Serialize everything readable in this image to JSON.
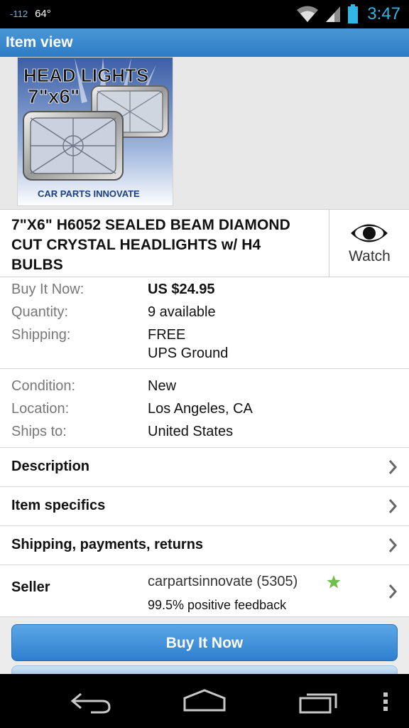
{
  "status_bar": {
    "signal_text": "-112",
    "temperature": "64°",
    "time": "3:47"
  },
  "action_bar": {
    "title": "Item view"
  },
  "listing": {
    "image_caption_top": "HEAD LIGHTS",
    "image_caption_size": "7\"x6\"",
    "image_brand": "CAR PARTS INNOVATE",
    "title": "7\"X6\" H6052 SEALED BEAM DIAMOND CUT CRYSTAL HEADLIGHTS w/ H4 BULBS",
    "watch_label": "Watch"
  },
  "pricing": {
    "buy_it_now_label": "Buy It Now:",
    "buy_it_now_value": "US $24.95",
    "quantity_label": "Quantity:",
    "quantity_value": "9 available",
    "shipping_label": "Shipping:",
    "shipping_cost": "FREE",
    "shipping_method": "UPS Ground"
  },
  "info": {
    "condition_label": "Condition:",
    "condition_value": "New",
    "location_label": "Location:",
    "location_value": "Los Angeles, CA",
    "ships_to_label": "Ships to:",
    "ships_to_value": "United States"
  },
  "sections": {
    "description": "Description",
    "item_specifics": "Item specifics",
    "shipping_payments_returns": "Shipping, payments, returns"
  },
  "seller": {
    "label": "Seller",
    "name_score": "carpartsinnovate (5305)",
    "feedback": "99.5% positive feedback"
  },
  "actions": {
    "buy_it_now": "Buy It Now"
  },
  "colors": {
    "accent_blue": "#2d7cc4",
    "free_orange": "#f08a1c",
    "star_green": "#6cc04a",
    "clock_blue": "#33b5e5"
  }
}
